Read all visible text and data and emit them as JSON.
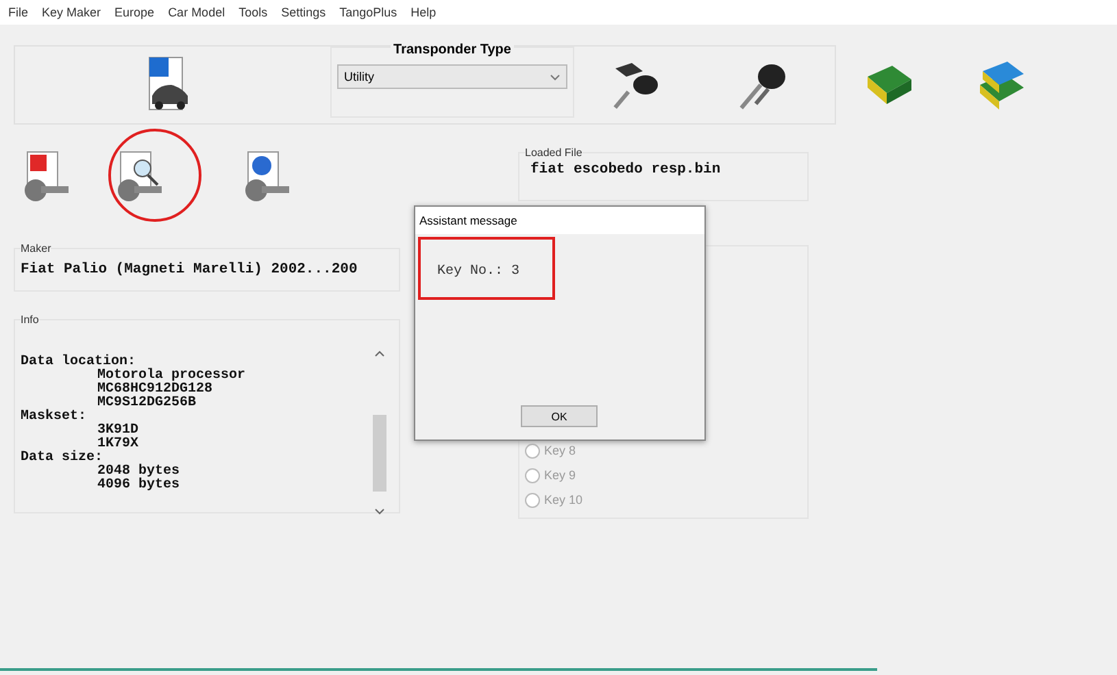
{
  "menu": [
    "File",
    "Key Maker",
    "Europe",
    "Car Model",
    "Tools",
    "Settings",
    "TangoPlus",
    "Help"
  ],
  "toolbar": {
    "transponder_type": {
      "label": "Transponder Type",
      "value": "Utility"
    }
  },
  "maker": {
    "label": "Maker",
    "value": "Fiat Palio (Magneti Marelli) 2002...200"
  },
  "info": {
    "label": "Info",
    "sections": [
      {
        "heading": "Data location:",
        "lines": [
          "Motorola processor",
          "MC68HC912DG128",
          "MC9S12DG256B"
        ]
      },
      {
        "heading": "Maskset:",
        "lines": [
          "3K91D",
          "1K79X"
        ]
      },
      {
        "heading": "Data size:",
        "lines": [
          "2048 bytes",
          "4096 bytes"
        ]
      }
    ]
  },
  "loaded_file": {
    "label": "Loaded File",
    "value": "fiat escobedo resp.bin"
  },
  "keys": [
    {
      "label": "Key 8",
      "selected": false,
      "disabled": true
    },
    {
      "label": "Key 9",
      "selected": false,
      "disabled": true
    },
    {
      "label": "Key 10",
      "selected": false,
      "disabled": true
    }
  ],
  "dialog": {
    "title": "Assistant message",
    "message": "Key No.: 3",
    "button": "OK"
  }
}
